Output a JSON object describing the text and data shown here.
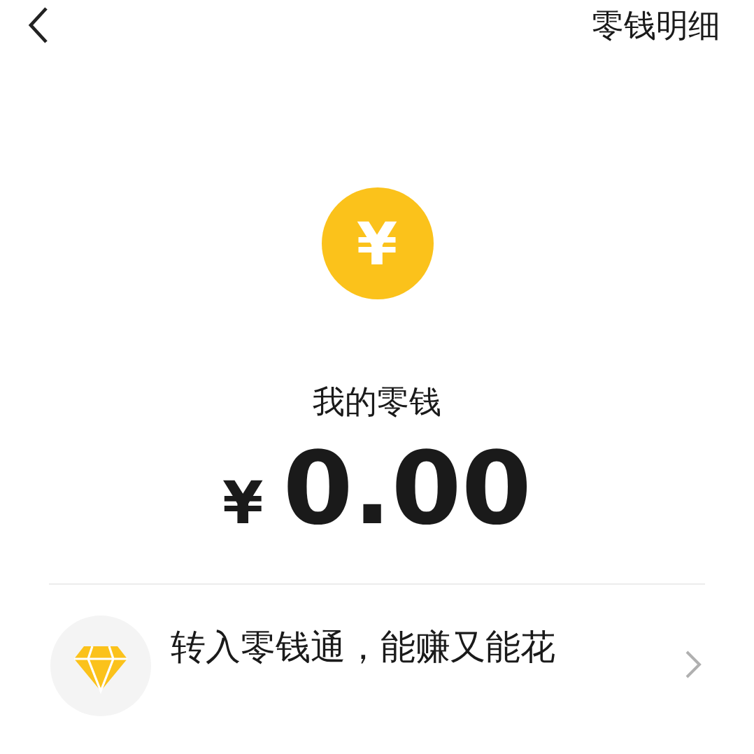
{
  "header": {
    "title": "零钱明细"
  },
  "balance": {
    "label": "我的零钱",
    "currency": "¥",
    "amount": "0.00",
    "coin_symbol": "¥"
  },
  "promo": {
    "title": "转入零钱通，能赚又能花"
  }
}
